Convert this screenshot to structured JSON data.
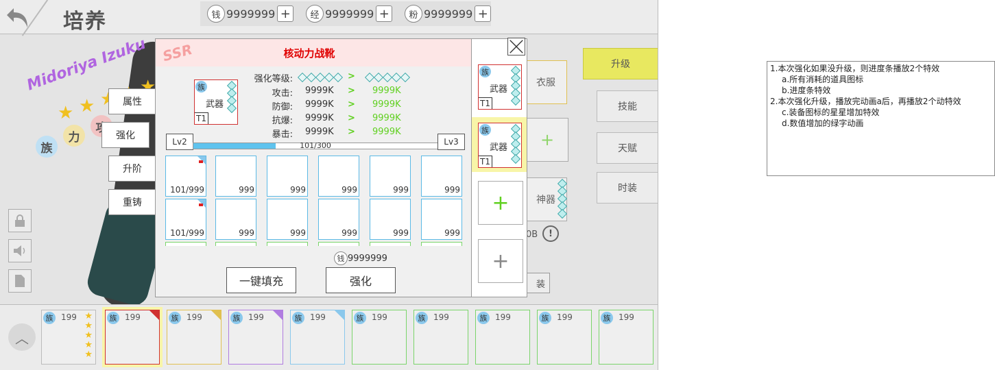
{
  "header": {
    "title": "培养",
    "currencies": [
      {
        "icon": "钱",
        "value": "9999999"
      },
      {
        "icon": "经",
        "value": "9999999"
      },
      {
        "icon": "粉",
        "value": "9999999"
      }
    ],
    "plus": "+"
  },
  "character": {
    "name": "Midoriya Izuku",
    "stars": 5,
    "attrs": [
      "族",
      "力",
      "攻"
    ]
  },
  "left_menu": [
    "属性",
    "强化",
    "升阶",
    "重铸"
  ],
  "right_tabs": [
    "升级",
    "技能",
    "天赋",
    "时装"
  ],
  "slots": {
    "clothes": "衣服",
    "artifact": "神器",
    "plus": "+",
    "partial_text": "0B",
    "exclaim": "!",
    "partial_btn": "装"
  },
  "modal": {
    "rarity": "SSR",
    "item_name": "核动力战靴",
    "equip": {
      "tag": "族",
      "name": "武器",
      "tier": "T1",
      "stars": 4
    },
    "stats": [
      {
        "label": "强化等级:",
        "current": "",
        "next": ""
      },
      {
        "label": "攻击:",
        "current": "9999K",
        "next": "9999K"
      },
      {
        "label": "防御:",
        "current": "9999K",
        "next": "9999K"
      },
      {
        "label": "抗爆:",
        "current": "9999K",
        "next": "9999K"
      },
      {
        "label": "暴击:",
        "current": "9999K",
        "next": "9999K"
      }
    ],
    "arrow": ">",
    "level_from": "Lv2",
    "level_to": "Lv3",
    "progress_text": "101/300",
    "progress": 0.337,
    "materials": [
      {
        "count": "101/999",
        "mark": true
      },
      {
        "count": "999"
      },
      {
        "count": "999"
      },
      {
        "count": "999"
      },
      {
        "count": "999"
      },
      {
        "count": "999"
      },
      {
        "count": "101/999",
        "mark": true
      },
      {
        "count": "999"
      },
      {
        "count": "999"
      },
      {
        "count": "999"
      },
      {
        "count": "999"
      },
      {
        "count": "999"
      }
    ],
    "cost_icon": "钱",
    "cost_value": "9999999",
    "fill_button": "一键填充",
    "enhance_button": "强化"
  },
  "side_panel": {
    "equips": [
      {
        "tag": "族",
        "name": "武器",
        "tier": "T1"
      },
      {
        "tag": "族",
        "name": "武器",
        "tier": "T1"
      }
    ],
    "plus": "+"
  },
  "bottom_cards": [
    {
      "tag": "族",
      "level": "199",
      "stars": 5,
      "border": "#bbbbbb"
    },
    {
      "tag": "族",
      "level": "199",
      "border": "#d03030",
      "corner": "#d03030",
      "selected": true
    },
    {
      "tag": "族",
      "level": "199",
      "border": "#e0c050",
      "corner": "#e0c050"
    },
    {
      "tag": "族",
      "level": "199",
      "border": "#b07ce0",
      "corner": "#b07ce0"
    },
    {
      "tag": "族",
      "level": "199",
      "border": "#8ac8ec",
      "corner": "#8ac8ec"
    },
    {
      "tag": "族",
      "level": "199",
      "border": "#7ad46a"
    },
    {
      "tag": "族",
      "level": "199",
      "border": "#7ad46a"
    },
    {
      "tag": "族",
      "level": "199",
      "border": "#7ad46a"
    },
    {
      "tag": "族",
      "level": "199",
      "border": "#7ad46a"
    },
    {
      "tag": "族",
      "level": "199",
      "border": "#7ad46a"
    }
  ],
  "notes": [
    {
      "text": "1.本次强化如果没升级，则进度条播放2个特效",
      "sub": false
    },
    {
      "text": "a.所有消耗的道具图标",
      "sub": true
    },
    {
      "text": "b.进度条特效",
      "sub": true
    },
    {
      "text": "2.本次强化升级，播放完动画a后，再播放2个动特效",
      "sub": false
    },
    {
      "text": "c.装备图标的星星增加特效",
      "sub": true
    },
    {
      "text": "d.数值增加的绿字动画",
      "sub": true
    }
  ],
  "colors": {
    "accent_yellow": "#e8e860",
    "progress_blue": "#5fc3ee",
    "stat_green": "#60d020",
    "item_red": "#e00000"
  }
}
